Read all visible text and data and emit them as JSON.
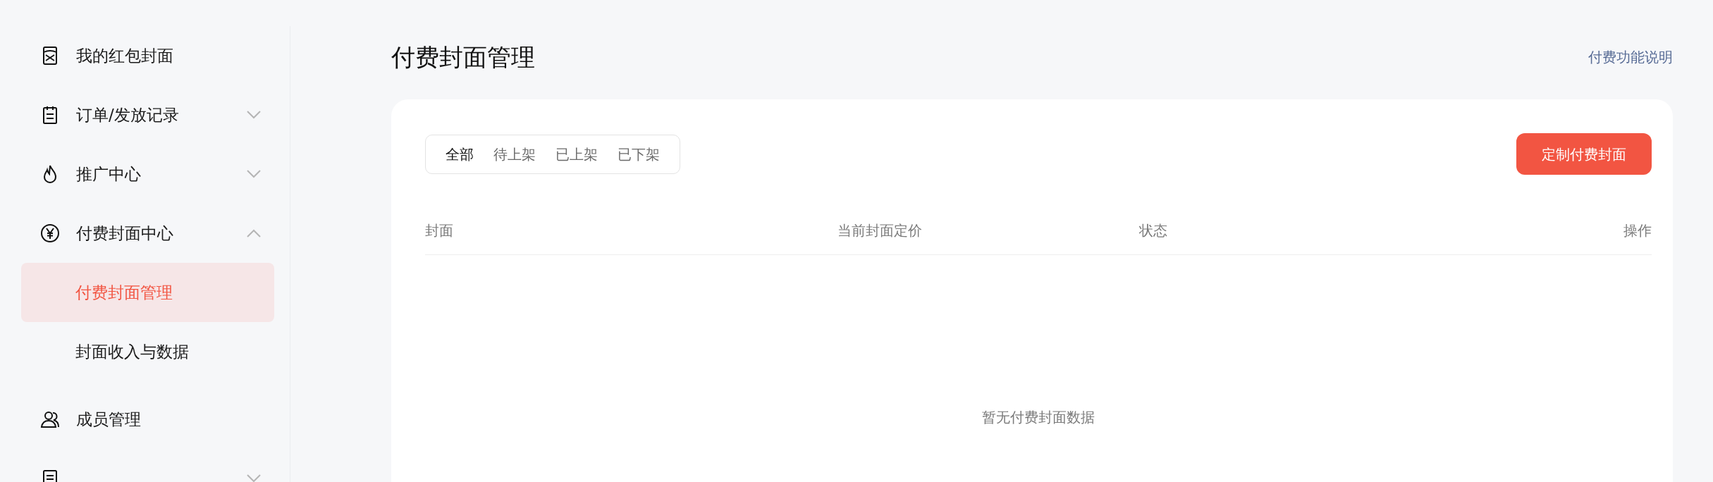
{
  "sidebar": {
    "items": [
      {
        "label": "我的红包封面"
      },
      {
        "label": "订单/发放记录",
        "expanded": false
      },
      {
        "label": "推广中心",
        "expanded": false
      },
      {
        "label": "付费封面中心",
        "expanded": true,
        "children": [
          {
            "label": "付费封面管理",
            "selected": true
          },
          {
            "label": "封面收入与数据",
            "selected": false
          }
        ]
      },
      {
        "label": "成员管理"
      },
      {
        "expanded": false
      }
    ]
  },
  "page": {
    "title": "付费封面管理",
    "help_link": "付费功能说明"
  },
  "tabs": [
    {
      "label": "全部",
      "selected": true
    },
    {
      "label": "待上架",
      "selected": false
    },
    {
      "label": "已上架",
      "selected": false
    },
    {
      "label": "已下架",
      "selected": false
    }
  ],
  "primary_button": "定制付费封面",
  "table": {
    "columns": [
      "封面",
      "当前封面定价",
      "状态",
      "操作"
    ],
    "empty_text": "暂无付费封面数据"
  }
}
